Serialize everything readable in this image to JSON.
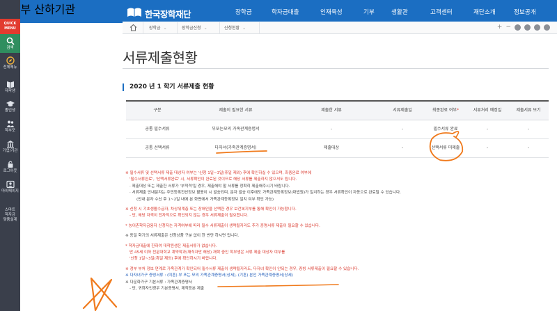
{
  "header": {
    "brand_small": "교육부 산하기관",
    "brand": "한국장학재단",
    "menu": [
      "장학금",
      "학자금대출",
      "인재육성",
      "기부",
      "생활관",
      "고객센터",
      "재단소개",
      "정보공개"
    ]
  },
  "side": {
    "quick": [
      "QUICK",
      "MENU"
    ],
    "items": [
      {
        "label": "검색",
        "icon": "search-icon"
      },
      {
        "label": "전체메뉴",
        "icon": "compass-icon"
      },
      {
        "label": "재학생",
        "icon": "book-icon"
      },
      {
        "label": "졸업생",
        "icon": "graduation-cap-icon"
      },
      {
        "label": "학부모",
        "icon": "parents-icon"
      },
      {
        "label": "기업/기관",
        "icon": "building-icon"
      },
      {
        "label": "로그아웃",
        "icon": "logout-icon"
      },
      {
        "label": "마이페이지",
        "icon": "mypage-icon"
      },
      {
        "label": "스마트",
        "icon": ""
      },
      {
        "label": "학자금",
        "icon": ""
      },
      {
        "label": "맞춤설계",
        "icon": ""
      }
    ]
  },
  "breadcrumb": {
    "items": [
      "장학금",
      "장학금신청",
      "신청현황"
    ]
  },
  "page": {
    "title": "서류제출현황",
    "section": "2020 년 1 학기 서류제출 현황"
  },
  "table": {
    "headers": [
      "구분",
      "제출이 필요한 서류",
      "제출한 서류",
      "서류제출일",
      "최종완료 여부",
      "서류처리 예정일",
      "제출서류 보기"
    ],
    "rows": [
      [
        "공통 필수서류",
        "부또는모의 가족관계증명서",
        "-",
        "-",
        "필수서류 완료",
        "-",
        "-"
      ],
      [
        "공통 선택서류",
        "다자녀(가족관계증명서)",
        "제출대상",
        "-",
        "선택서류 미제출",
        "-",
        "-"
      ]
    ]
  },
  "notes": [
    "※ 필수서류 및 선택서류 제출 대상자 여부는 '신청 1일~3일(휴일 제외) 후에 확인하실 수 있으며, 최종완료 여부에",
    "'필수서류완료', '선택서류완료' 시, 서류확인이 완료된 것이므로 해당 서류를 제출하지 않으셔도 됩니다.",
    "· 제출대상 또는 제출한 서류가 '부적격'일 경우, 제출해야 할 서류를 정확히 제출해주시기 바랍니다.",
    "· 서류제출 안내문자는 주민등록전산정보 활용이 시 발송되며, 문자 발송 이후에도 가족관계등록정보(대법원)가 일치하는 경우 서류확인이 자동으로 완료될 수 있습니다.",
    "(안내 문자 수신 후 1~2일 내에 본 화면에서 가족관계등록정보 일치 여부 확인 가능)",
    "※ 신청 시 기초생활수급자, 차상위계층 또는 장애인을 선택한 경우 보건복지부를 통해 확인이 가능합니다.",
    "- 단, 해당 자격이 전자적으로 확인되지 않는 경우 서류제출이 필요합니다.",
    "* 농어촌학자금융자 신청자는 자격여부에 따라 필수 서류제출이 생략될지라도 추가 증명서류 제출이 필요할 수 있습니다.",
    "※ 동일 학기의 서류제출은 신청상품 구분 없이 한 번만 하시면 됩니다.",
    "* 학자금대출에 한하여 대학원생은 제출서류가 없습니다.",
    "만 45세 이하 전문대학교 계약학과(재직자만 해당) 재학 중인 학부생은 서류 제출 대상자 여부를",
    "'신청 1일~3일(휴일 제외) 후에 확인하시기 바랍니다.",
    "※ 정부 부처 정보 연계로 가족관계가 확인되어 필수서류 제출이 생략될지라도, 다자녀 확인이 안되는 경우, 증빙 서류제출이 필요할 수 있습니다.",
    "※ 다자녀가구 증빙서류 : (미혼) 부 또는 모의 가족관계증명서(상세), (기혼) 본인 가족관계증명서(상세)",
    "※ 다문화가구 기본서류 : 가족관계증명서",
    "- 단, 귀화자인경우 기본증명서, 제적등본 제출"
  ]
}
